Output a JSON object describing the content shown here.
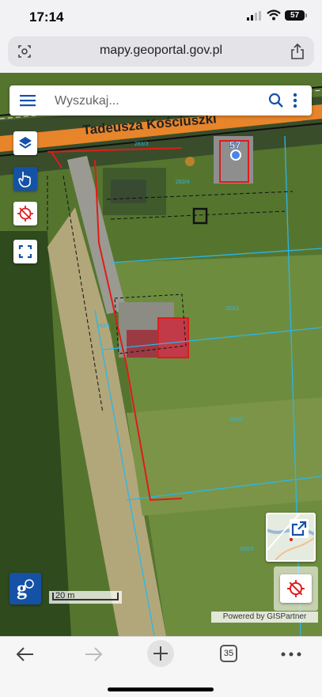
{
  "status_bar": {
    "time": "17:14",
    "battery": "57"
  },
  "browser": {
    "url": "mapy.geoportal.gov.pl",
    "tabs_count": "35"
  },
  "map": {
    "search": {
      "placeholder": "Wyszukaj..."
    },
    "street_label": "Tadeusza Kościuszki",
    "building_number": "57",
    "parcel_labels": [
      "282/4",
      "283/1",
      "282/1",
      "283/2",
      "283/3",
      "283/3"
    ],
    "scale_label": "20 m",
    "attribution": "Powered by GISPartner"
  },
  "colors": {
    "brand_blue": "#1552a6",
    "street_orange": "#e8852a",
    "parcel_red": "#e01b1b",
    "parcel_cyan": "#2bb6e8"
  }
}
